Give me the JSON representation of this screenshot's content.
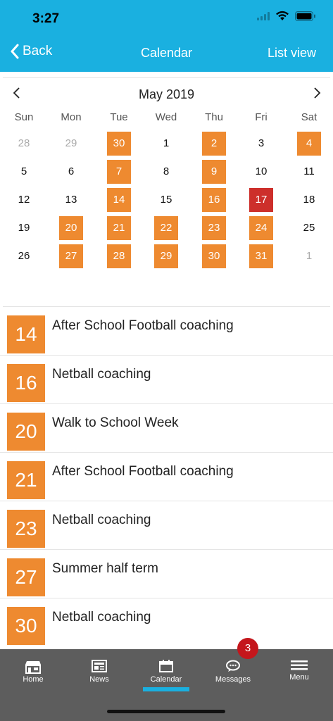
{
  "status_bar": {
    "time": "3:27"
  },
  "nav": {
    "back_label": "Back",
    "title": "Calendar",
    "list_view_label": "List view"
  },
  "calendar": {
    "month_label": "May 2019",
    "weekdays": [
      "Sun",
      "Mon",
      "Tue",
      "Wed",
      "Thu",
      "Fri",
      "Sat"
    ],
    "weeks": [
      [
        {
          "d": "28",
          "s": "muted"
        },
        {
          "d": "29",
          "s": "muted"
        },
        {
          "d": "30",
          "s": "event"
        },
        {
          "d": "1",
          "s": ""
        },
        {
          "d": "2",
          "s": "event"
        },
        {
          "d": "3",
          "s": ""
        },
        {
          "d": "4",
          "s": "event"
        }
      ],
      [
        {
          "d": "5",
          "s": ""
        },
        {
          "d": "6",
          "s": ""
        },
        {
          "d": "7",
          "s": "event"
        },
        {
          "d": "8",
          "s": ""
        },
        {
          "d": "9",
          "s": "event"
        },
        {
          "d": "10",
          "s": ""
        },
        {
          "d": "11",
          "s": ""
        }
      ],
      [
        {
          "d": "12",
          "s": ""
        },
        {
          "d": "13",
          "s": ""
        },
        {
          "d": "14",
          "s": "event"
        },
        {
          "d": "15",
          "s": ""
        },
        {
          "d": "16",
          "s": "event"
        },
        {
          "d": "17",
          "s": "today"
        },
        {
          "d": "18",
          "s": ""
        }
      ],
      [
        {
          "d": "19",
          "s": ""
        },
        {
          "d": "20",
          "s": "event"
        },
        {
          "d": "21",
          "s": "event"
        },
        {
          "d": "22",
          "s": "event"
        },
        {
          "d": "23",
          "s": "event"
        },
        {
          "d": "24",
          "s": "event"
        },
        {
          "d": "25",
          "s": ""
        }
      ],
      [
        {
          "d": "26",
          "s": ""
        },
        {
          "d": "27",
          "s": "event"
        },
        {
          "d": "28",
          "s": "event"
        },
        {
          "d": "29",
          "s": "event"
        },
        {
          "d": "30",
          "s": "event"
        },
        {
          "d": "31",
          "s": "event"
        },
        {
          "d": "1",
          "s": "muted"
        }
      ]
    ]
  },
  "events": [
    {
      "date": "14",
      "title": "After School Football coaching"
    },
    {
      "date": "16",
      "title": "Netball coaching"
    },
    {
      "date": "20",
      "title": "Walk to School Week"
    },
    {
      "date": "21",
      "title": "After School Football coaching"
    },
    {
      "date": "23",
      "title": "Netball coaching"
    },
    {
      "date": "27",
      "title": "Summer half term"
    },
    {
      "date": "30",
      "title": "Netball coaching"
    }
  ],
  "tabs": [
    {
      "label": "Home",
      "icon": "home-icon"
    },
    {
      "label": "News",
      "icon": "news-icon"
    },
    {
      "label": "Calendar",
      "icon": "calendar-icon"
    },
    {
      "label": "Messages",
      "icon": "messages-icon"
    },
    {
      "label": "Menu",
      "icon": "menu-icon"
    }
  ],
  "active_tab": "Calendar",
  "messages_badge": "3",
  "colors": {
    "brand": "#1ab0e0",
    "event": "#ee8a30",
    "today": "#cd2f2b",
    "tab_bar": "#5d5d5d",
    "badge": "#c4161c"
  }
}
